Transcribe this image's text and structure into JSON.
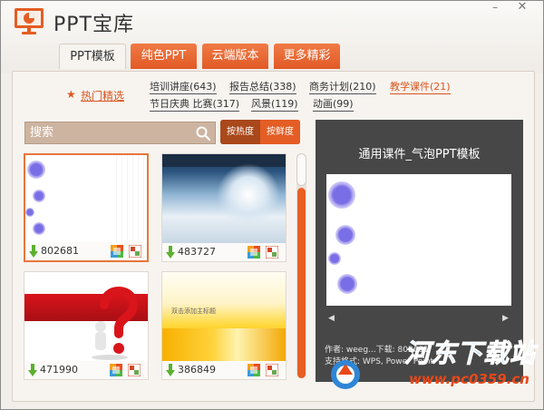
{
  "app": {
    "title": "PPT宝库"
  },
  "window_controls": {
    "minimize": "–",
    "close": "✕"
  },
  "tabs": [
    {
      "label": "PPT模板",
      "active": true
    },
    {
      "label": "纯色PPT",
      "active": false
    },
    {
      "label": "云端版本",
      "active": false
    },
    {
      "label": "更多精彩",
      "active": false
    }
  ],
  "filter": {
    "hot_label": "热门精选",
    "categories": [
      {
        "label": "培训讲座(643)"
      },
      {
        "label": "报告总结(338)"
      },
      {
        "label": "商务计划(210)"
      },
      {
        "label": "教学课件(21)",
        "selected": true
      },
      {
        "label": "节日庆典 比赛(317)"
      },
      {
        "label": "风景(119)"
      },
      {
        "label": "动画(99)"
      }
    ]
  },
  "search": {
    "placeholder": "搜索"
  },
  "sort": {
    "by_heat": "按热度",
    "by_fresh": "按鲜度"
  },
  "templates": [
    {
      "count": "802681",
      "selected": true
    },
    {
      "count": "483727"
    },
    {
      "count": "471990"
    },
    {
      "count": "386849",
      "thumb_text": "双击添加主标题"
    }
  ],
  "preview": {
    "title": "通用课件_气泡PPT模板",
    "author_line": "作者: weeg...下载: 802681",
    "format_line": "支持格式: WPS, Power Point"
  },
  "watermark": {
    "text": "河东下载站",
    "url": "www.pc0359.cn"
  },
  "colors": {
    "accent": "#e45d24",
    "tab_orange": "#f07a45",
    "preview_bg": "#474747",
    "bubble": "#7a6ee6"
  },
  "icons": [
    "ppt-logo-icon",
    "star-icon",
    "search-icon",
    "download-icon",
    "wps-icon",
    "powerpoint-icon",
    "chevron-left-icon",
    "chevron-right-icon"
  ]
}
